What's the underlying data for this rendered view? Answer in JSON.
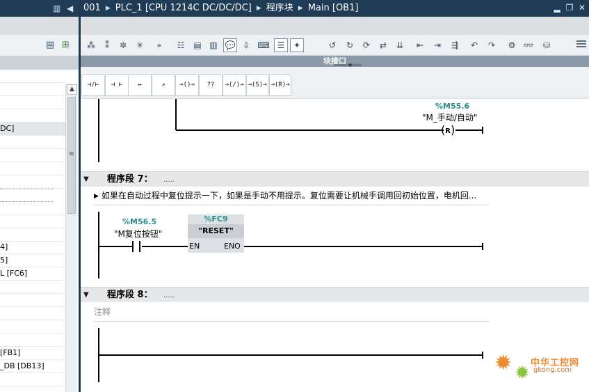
{
  "left_pane": {
    "tree_items": [
      "DC]",
      "4]",
      "5]",
      "L [FC6]",
      "[FB1]",
      "_DB [DB13]"
    ]
  },
  "editor": {
    "breadcrumb": [
      "001",
      "PLC_1 [CPU 1214C DC/DC/DC]",
      "程序块",
      "Main [OB1]"
    ],
    "interface_label": "块接口",
    "favorites": [
      "⊣/⊢",
      "⊣ ⊢",
      "↦",
      "↗",
      "⊸()⊸",
      "??",
      "⊸(/)⊸",
      "⊸(S)⊸",
      "⊸(R)⊸"
    ],
    "network6": {
      "coil_address": "%M55.6",
      "coil_symbol": "\"M_手动/自动\"",
      "coil_type": "R"
    },
    "network7": {
      "title": "程序段 7：",
      "title_dots": ".....",
      "comment": "如果在自动过程中复位提示一下，如果是手动不用提示。复位需要让机械手调用回初始位置，电机回...",
      "contact_address": "%M56.5",
      "contact_symbol": "\"M复位按钮\"",
      "block_address": "%FC9",
      "block_name": "\"RESET\"",
      "pin_en": "EN",
      "pin_eno": "ENO"
    },
    "network8": {
      "title": "程序段 8：",
      "title_dots": ".....",
      "comment_placeholder": "注释"
    }
  },
  "watermark": {
    "name": "中华工控网",
    "domain": "gkong.com"
  },
  "colors": {
    "titlebar": "#1f3b55",
    "address_teal": "#2b8c8c",
    "toolbar_bg": "#eef1f4",
    "network_header": "#e5e7e9",
    "watermark_orange": "#f08a2e"
  }
}
